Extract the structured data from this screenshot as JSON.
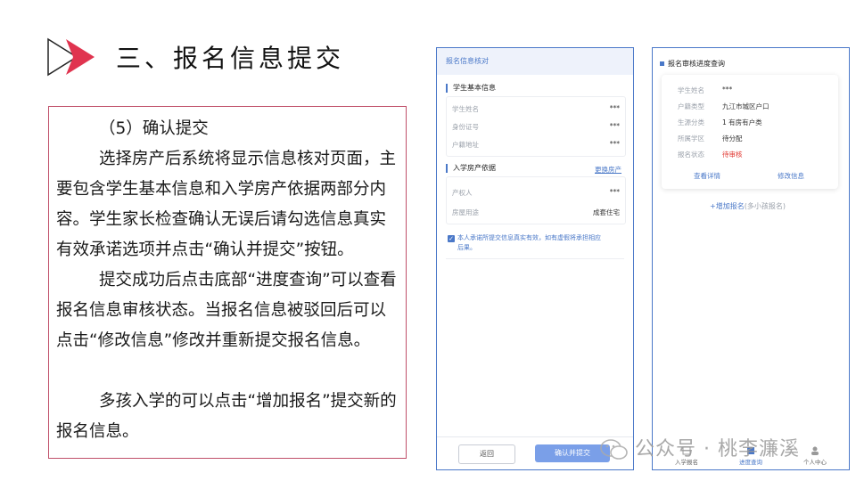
{
  "slide": {
    "title": "三、报名信息提交"
  },
  "text": {
    "heading": "（5）确认提交",
    "para1": "选择房产后系统将显示信息核对页面，主要包含学生基本信息和入学房产依据两部分内容。学生家长检查确认无误后请勾选信息真实有效承诺选项并点击“确认并提交”按钮。",
    "para2": "提交成功后点击底部“进度查询”可以查看报名信息审核状态。当报名信息被驳回后可以点击“修改信息”修改并重新提交报名信息。",
    "para3": "多孩入学的可以点击“增加报名”提交新的报名信息。"
  },
  "verify_page": {
    "header": "报名信息核对",
    "student_section": "学生基本信息",
    "student_rows": [
      {
        "label": "学生姓名",
        "value": "***"
      },
      {
        "label": "身份证号",
        "value": "***"
      },
      {
        "label": "户籍地址",
        "value": "***"
      }
    ],
    "house_section": "入学房产依据",
    "change_house_link": "更换房产",
    "house_rows": [
      {
        "label": "产权人",
        "value": "***"
      },
      {
        "label": "房屋用途",
        "value": "成套住宅"
      }
    ],
    "promise_text_line1": "本人承诺所提交信息真实有效，如有虚假将承担相应",
    "promise_text_line2": "后果。",
    "back_button": "返回",
    "submit_button": "确认并提交"
  },
  "progress_page": {
    "title": "报名审核进度查询",
    "rows": [
      {
        "label": "学生姓名",
        "value": "***"
      },
      {
        "label": "户籍类型",
        "value": "九江市城区户口"
      },
      {
        "label": "生源分类",
        "value": "1 有房有户类"
      },
      {
        "label": "所属学区",
        "value": "待分配"
      },
      {
        "label": "报名状态",
        "value": "待审核"
      }
    ],
    "detail_action": "查看详情",
    "modify_action": "修改信息",
    "add_link": "+增加报名",
    "add_link_note": "(多小孩报名)",
    "tabs": [
      {
        "label": "入学报名"
      },
      {
        "label": "进度查询"
      },
      {
        "label": "个人中心"
      }
    ]
  },
  "watermark": "公众号 · 桃李濂溪",
  "colors": {
    "accent": "#4a78c8",
    "logo_red": "#e0344f",
    "status_red": "#e0342e"
  }
}
